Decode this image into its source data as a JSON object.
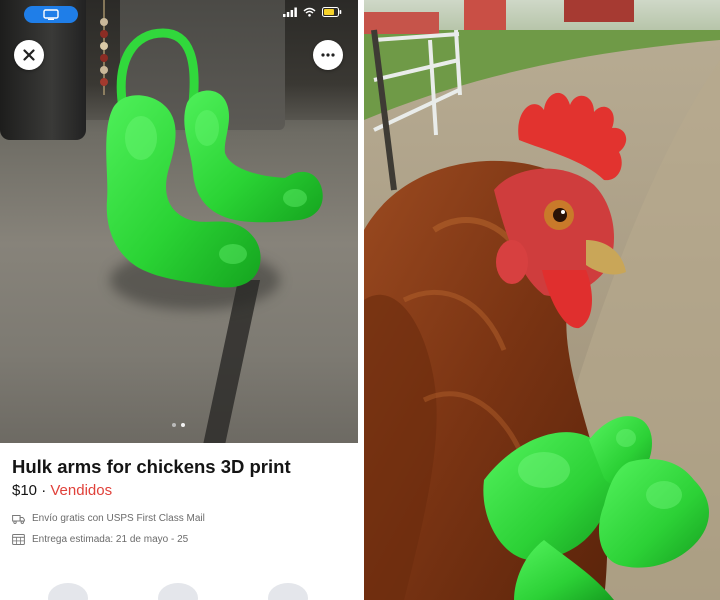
{
  "listing": {
    "title": "Hulk arms for chickens 3D print",
    "price": "$10",
    "price_separator": " · ",
    "sold_label": "Vendidos",
    "shipping": "Envío gratis con USPS First Class Mail",
    "delivery": "Entrega estimada: 21 de mayo - 25"
  },
  "carousel": {
    "total": 2,
    "current": 2
  },
  "icons": {
    "close": "close-icon",
    "more": "more-icon",
    "shipping": "truck-icon",
    "delivery": "calendar-icon",
    "status": [
      "screen-mirror-icon",
      "signal-icon",
      "wifi-icon",
      "battery-icon"
    ]
  },
  "colors": {
    "sold": "#e0413a",
    "status_pill": "#1f7ee8",
    "hulk_green": "#2fd43c"
  }
}
